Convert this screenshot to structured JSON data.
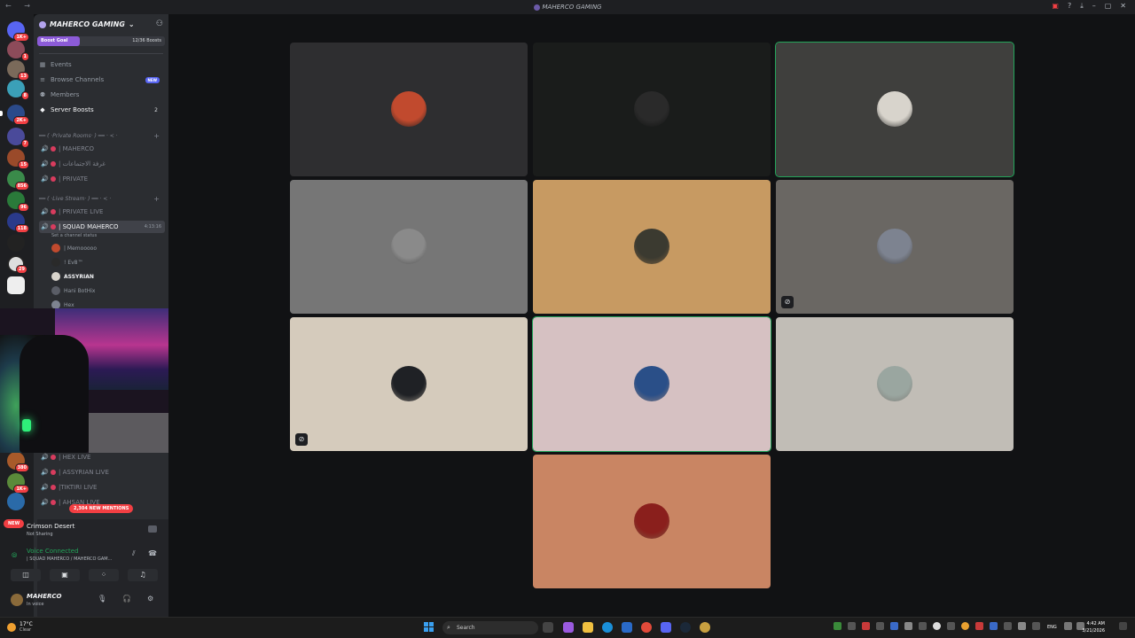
{
  "titlebar": {
    "title": "MAHERCO GAMING",
    "nav_arrows": "← →"
  },
  "guild_rail": {
    "badges": [
      "1K+",
      "1",
      "13",
      "8",
      "2K+",
      "7",
      "15",
      "856",
      "96",
      "118",
      "",
      "29",
      "",
      "",
      "380",
      "1K+"
    ],
    "new_label": "NEW"
  },
  "server": {
    "name": "MAHERCO GAMING",
    "boost_label": "Boost Goal",
    "boost_count": "12/36 Boosts",
    "boost_progress": 0.333,
    "nav": [
      {
        "label": "Events",
        "icon": "calendar-icon"
      },
      {
        "label": "Browse Channels",
        "icon": "browse-icon",
        "badge": "NEW"
      },
      {
        "label": "Members",
        "icon": "members-icon"
      },
      {
        "label": "Server Boosts",
        "icon": "boost-icon",
        "count": "2"
      }
    ],
    "categories": [
      {
        "label": "━━ ( ·Private Rooms· ) ━━ · <  ·"
      },
      {
        "label": "━━ ( ·Live Stream· ) ━━ · <  ·"
      }
    ],
    "private_channels": [
      "| MAHERCO",
      "| غرفة الاجتماعات",
      "| PRIVATE"
    ],
    "live_channels": [
      "| PRIVATE LIVE",
      "| SQUAD MAHERCO"
    ],
    "selected_channel_time": "4:13:16",
    "channel_status": "Set a channel status",
    "members_in_channel": [
      "| Memooooo",
      "! Ev8™",
      "ASSYRIAN",
      "Hani BotHix",
      "Hex"
    ],
    "lower_channels": [
      "| HEX LIVE",
      "| ASSYRIAN LIVE",
      "|TIKTIRI LIVE",
      "| AHSAN LIVE"
    ],
    "mentions_pill": "2,304 NEW MENTIONS"
  },
  "activity": {
    "game": "Crimson Desert",
    "sub": "Not Sharing"
  },
  "voice": {
    "title": "Voice Connected",
    "sub": "| SQUAD MAHERCO / MAHERCO GAM..."
  },
  "user": {
    "name": "MAHERCO",
    "status": "In voice"
  },
  "taskbar": {
    "temp": "17°C",
    "weather": "Clear",
    "search_placeholder": "Search",
    "lang": "ENG",
    "time": "4:42 AM",
    "date": "3/21/2026"
  },
  "tiles": [
    {
      "bg": "#2e2e30",
      "avatar": "#c14a2e",
      "speaking": false,
      "muted": false
    },
    {
      "bg": "#1a1c1b",
      "avatar": "#2a2a2a",
      "speaking": false,
      "muted": false
    },
    {
      "bg": "#3f3f3d",
      "avatar": "#d8d4cc",
      "speaking": true,
      "muted": false
    },
    {
      "bg": "#767676",
      "avatar": "#8a8a8a",
      "speaking": false,
      "muted": false
    },
    {
      "bg": "#c79a62",
      "avatar": "#3b3a30",
      "speaking": false,
      "muted": false
    },
    {
      "bg": "#6a6763",
      "avatar": "#7d8390",
      "speaking": false,
      "muted": true
    },
    {
      "bg": "#d5cbbc",
      "avatar": "#1f2125",
      "speaking": false,
      "muted": true
    },
    {
      "bg": "#d6c1c2",
      "avatar": "#2a4f88",
      "speaking": true,
      "muted": false
    },
    {
      "bg": "#c1bdb6",
      "avatar": "#9aa6a0",
      "speaking": false,
      "muted": false
    },
    {
      "bg": "#c98563",
      "avatar": "#8a1f1c",
      "speaking": false,
      "muted": false
    }
  ]
}
